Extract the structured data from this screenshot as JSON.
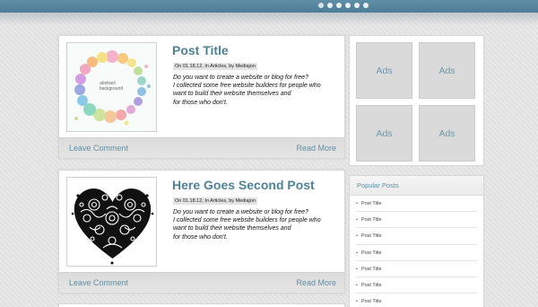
{
  "slider": {
    "dot_count": 6,
    "active_index": 0
  },
  "posts": [
    {
      "title": "Post Title",
      "meta": "On 01.18.12, In Articles, by Mediajon",
      "excerpt": [
        "Do you want to create a website or blog for free?",
        "I collected some free website builders for people who",
        "want to build their website themselves and",
        "for those who don't."
      ],
      "thumb_caption_line1": "abstract",
      "thumb_caption_line2": "background",
      "leave_comment": "Leave Comment",
      "read_more": "Read More"
    },
    {
      "title": "Here Goes Second Post",
      "meta": "On 01.18.12, In Articles, by Mediajon",
      "excerpt": [
        "Do you want to create a website or blog for free?",
        "I collected some free website builders for people who",
        "want to build their website themselves and",
        "for those who don't."
      ],
      "leave_comment": "Leave Comment",
      "read_more": "Read More"
    }
  ],
  "ads": [
    "Ads",
    "Ads",
    "Ads",
    "Ads"
  ],
  "popular": {
    "heading": "Popular Posts",
    "items": [
      "Post Title",
      "Post Title",
      "Post Title",
      "Post Title",
      "Post Title",
      "Post Title",
      "Post Title"
    ]
  },
  "colors": {
    "accent": "#4e8298",
    "topbar": "#5a89a2",
    "link": "#5f90a6"
  }
}
